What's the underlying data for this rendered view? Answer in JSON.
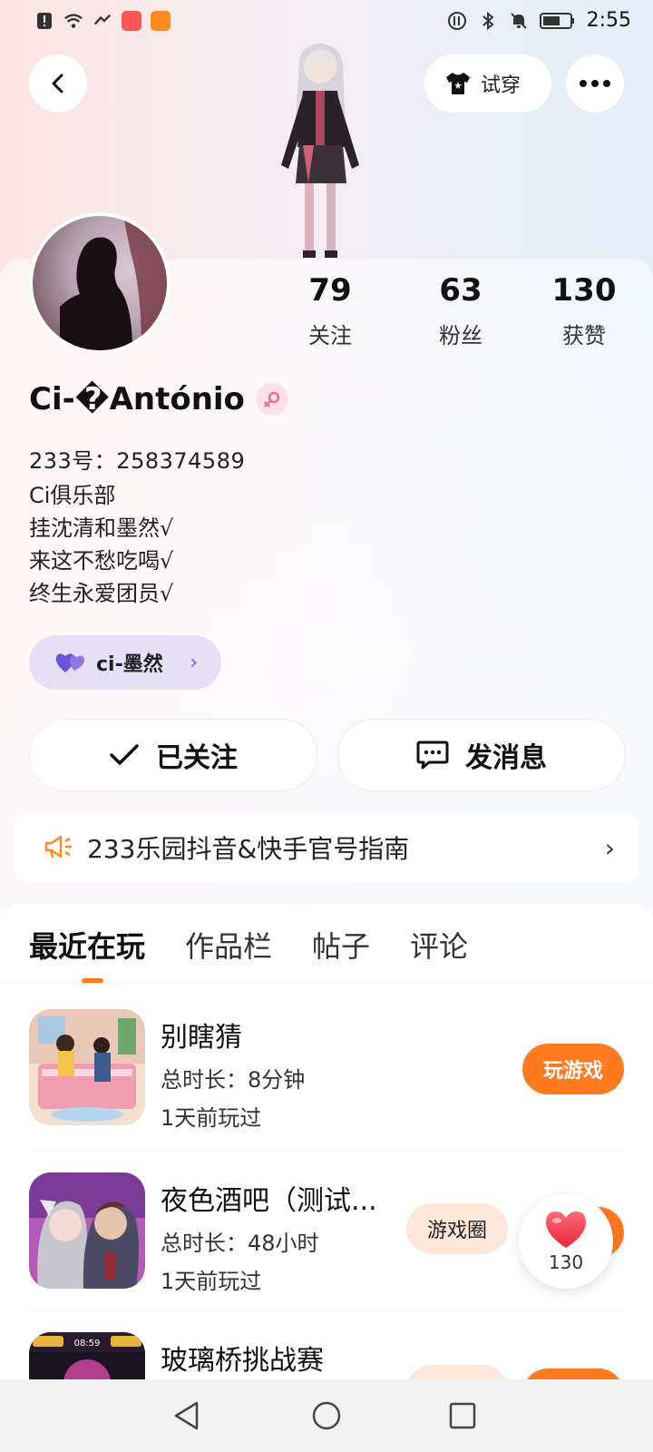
{
  "status_bar": {
    "time": "2:55",
    "icons": [
      "alert-icon",
      "wifi-icon",
      "data-icon",
      "app-badge-icon",
      "video-app-icon",
      "network-icon",
      "bluetooth-icon",
      "mute-icon",
      "battery-icon"
    ]
  },
  "header": {
    "back_icon": "chevron-left-icon",
    "try_label": "试穿",
    "more_icon": "more-icon"
  },
  "profile": {
    "name": "Ci-�António",
    "gender_icon": "female-icon",
    "uid": "233号：258374589",
    "bio": [
      "Ci俱乐部",
      "挂沈清和墨然√",
      "来这不愁吃喝√",
      "终生永爱团员√"
    ],
    "club_label": "ci-墨然"
  },
  "stats": [
    {
      "num": "79",
      "label": "关注"
    },
    {
      "num": "63",
      "label": "粉丝"
    },
    {
      "num": "130",
      "label": "获赞"
    }
  ],
  "actions": {
    "follow_label": "已关注",
    "message_label": "发消息"
  },
  "notice": {
    "text": "233乐园抖音&快手官号指南"
  },
  "tabs": [
    "最近在玩",
    "作品栏",
    "帖子",
    "评论"
  ],
  "games": [
    {
      "title": "别瞎猜",
      "duration": "总时长：8分钟",
      "last_played": "1天前玩过",
      "play_label": "玩游戏"
    },
    {
      "title": "夜色酒吧（测试...",
      "duration": "总时长：48小时",
      "last_played": "1天前玩过",
      "circle_label": "游戏圈",
      "play_label": "玩游戏"
    },
    {
      "title": "玻璃桥挑战赛",
      "thumb_hud": [
        "08:59"
      ]
    }
  ],
  "like_float": {
    "count": "130"
  },
  "colors": {
    "accent": "#ff7a1f",
    "chip": "#e6e0f6",
    "heart": "#f23b4a"
  }
}
